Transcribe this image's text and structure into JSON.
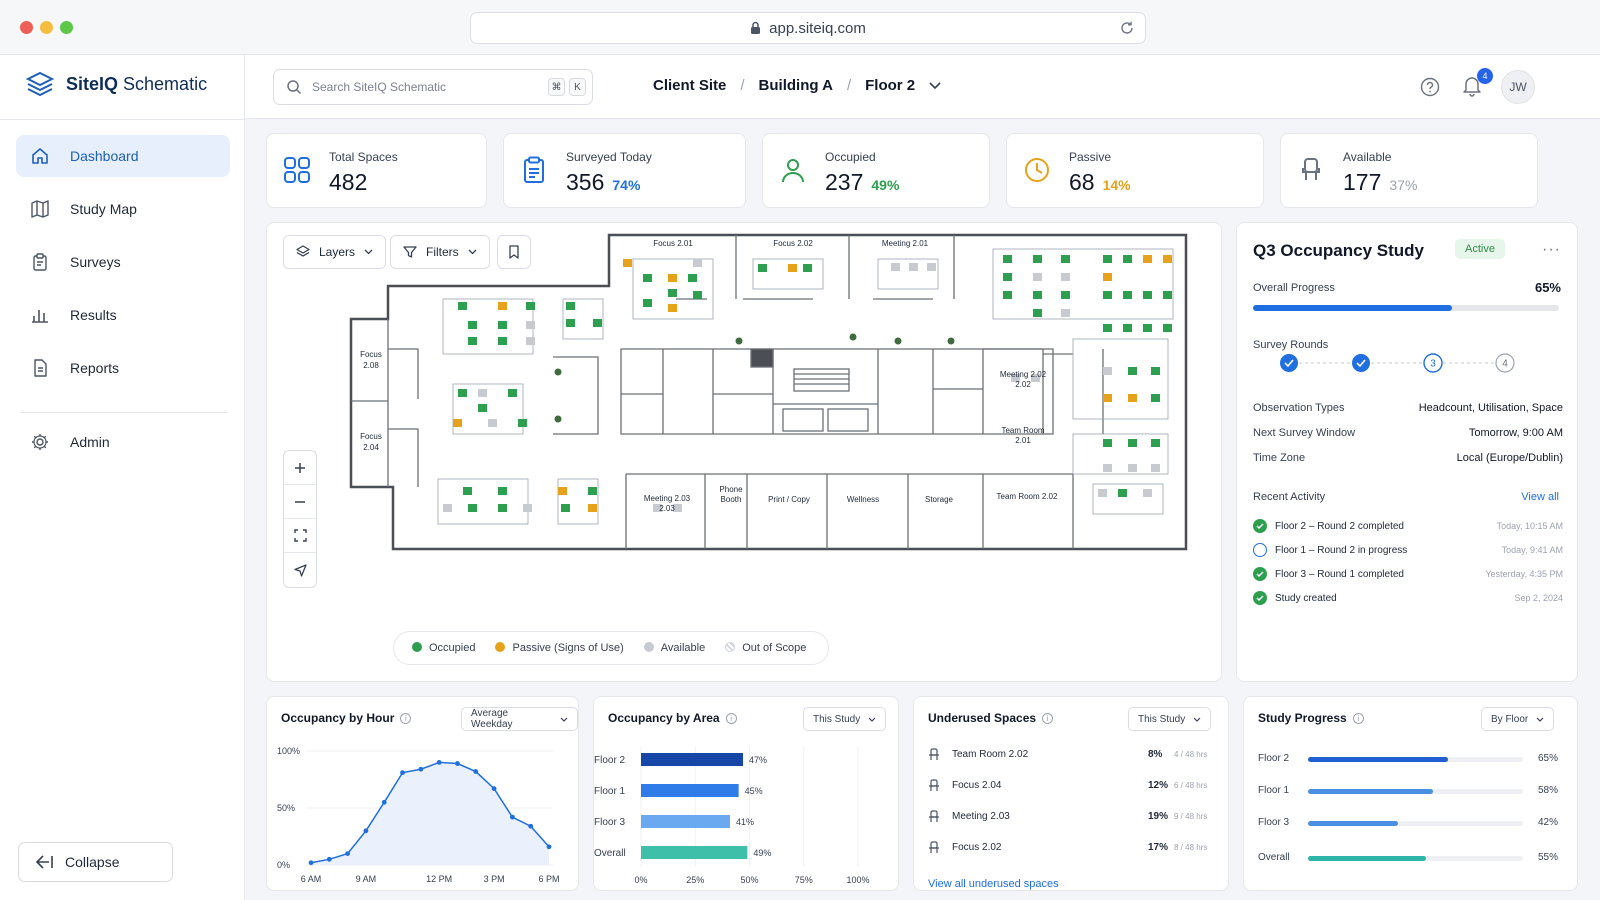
{
  "browser": {
    "url": "app.siteiq.com"
  },
  "app": {
    "name_bold": "SiteIQ",
    "name_light": "Schematic"
  },
  "sidebar": {
    "items": [
      {
        "label": "Dashboard",
        "icon": "home-icon",
        "active": true
      },
      {
        "label": "Study Map",
        "icon": "map-icon"
      },
      {
        "label": "Surveys",
        "icon": "clipboard-icon"
      },
      {
        "label": "Results",
        "icon": "bar-chart-icon"
      },
      {
        "label": "Reports",
        "icon": "document-icon"
      },
      {
        "label": "Admin",
        "icon": "gear-icon"
      }
    ],
    "collapse_label": "Collapse"
  },
  "topbar": {
    "search_placeholder": "Search SiteIQ Schematic",
    "kbd1": "⌘",
    "kbd2": "K",
    "breadcrumb": [
      "Client Site",
      "Building A",
      "Floor 2"
    ],
    "notifications": "4",
    "user_initials": "JW"
  },
  "kpis": [
    {
      "label": "Total Spaces",
      "value": "482",
      "pct": "",
      "icon": "grid-icon"
    },
    {
      "label": "Surveyed Today",
      "value": "356",
      "pct": "74%",
      "icon": "clipboard-icon",
      "color": "#1f6fe0"
    },
    {
      "label": "Occupied",
      "value": "237",
      "pct": "49%",
      "icon": "person-icon",
      "color": "#2e9e4f"
    },
    {
      "label": "Passive",
      "value": "68",
      "pct": "14%",
      "icon": "clock-icon",
      "color": "#e6a21b"
    },
    {
      "label": "Available",
      "value": "177",
      "pct": "37%",
      "icon": "chair-icon",
      "color": "#9ca3af"
    }
  ],
  "map": {
    "layers_label": "Layers",
    "filters_label": "Filters",
    "rooms": {
      "focus_201": "Focus 2.01",
      "focus_202": "Focus 2.02",
      "meeting_201": "Meeting 2.01",
      "focus_208_a": "Focus",
      "focus_208_b": "2.08",
      "focus_204_a": "Focus",
      "focus_204_b": "2.04",
      "meeting_202_a": "Meeting 2.02",
      "meeting_202_b": "2.02",
      "team_201_a": "Team Room",
      "team_201_b": "2.01",
      "meeting_203_a": "Meeting 2.03",
      "meeting_203_b": "2.03",
      "phone_a": "Phone",
      "phone_b": "Booth",
      "print": "Print / Copy",
      "wellness": "Wellness",
      "storage": "Storage",
      "team_202": "Team Room 2.02"
    },
    "legend": [
      {
        "label": "Occupied",
        "color": "#2e9e4f"
      },
      {
        "label": "Passive (Signs of Use)",
        "color": "#e6a21b"
      },
      {
        "label": "Available",
        "color": "#c7cbd1"
      },
      {
        "label": "Out of Scope",
        "color": "hatched"
      }
    ]
  },
  "study": {
    "title": "Q3 Occupancy Study",
    "status": "Active",
    "progress_label": "Overall Progress",
    "progress_value": "65%",
    "progress_fraction": 0.65,
    "rounds_label": "Survey Rounds",
    "rounds": [
      {
        "label": "",
        "state": "done"
      },
      {
        "label": "",
        "state": "done"
      },
      {
        "label": "3",
        "state": "current"
      },
      {
        "label": "4",
        "state": "upcoming"
      }
    ],
    "meta": [
      {
        "k": "Observation Types",
        "v": "Headcount, Utilisation, Space"
      },
      {
        "k": "Next Survey Window",
        "v": "Tomorrow, 9:00 AM"
      },
      {
        "k": "Time Zone",
        "v": "Local (Europe/Dublin)"
      }
    ],
    "activity_title": "Recent Activity",
    "activity_link": "View all",
    "activity": [
      {
        "text": "Floor 2 – Round 2 completed",
        "time": "Today, 10:15 AM",
        "state": "done"
      },
      {
        "text": "Floor 1 – Round 2 in progress",
        "time": "Today, 9:41 AM",
        "state": "progress"
      },
      {
        "text": "Floor 3 – Round 1 completed",
        "time": "Yesterday, 4:35 PM",
        "state": "done"
      },
      {
        "text": "Study created",
        "time": "Sep 2, 2024",
        "state": "done"
      }
    ]
  },
  "cards": {
    "hour": {
      "title": "Occupancy by Hour",
      "select": "Average Weekday"
    },
    "area": {
      "title": "Occupancy by Area",
      "select": "This Study"
    },
    "under": {
      "title": "Underused Spaces",
      "select": "This Study",
      "rows": [
        {
          "name": "Team Room 2.02",
          "pct": "8%",
          "hrs": "4 / 48 hrs"
        },
        {
          "name": "Focus 2.04",
          "pct": "12%",
          "hrs": "6 / 48 hrs"
        },
        {
          "name": "Meeting 2.03",
          "pct": "19%",
          "hrs": "9 / 48 hrs"
        },
        {
          "name": "Focus 2.02",
          "pct": "17%",
          "hrs": "8 / 48 hrs"
        }
      ],
      "link": "View all underused spaces"
    },
    "progress": {
      "title": "Study Progress",
      "select": "By Floor",
      "rows": [
        {
          "name": "Floor 2",
          "pct": "65%",
          "value": 65,
          "color": "#1f5fd1"
        },
        {
          "name": "Floor 1",
          "pct": "58%",
          "value": 58,
          "color": "#4a90e2"
        },
        {
          "name": "Floor 3",
          "pct": "42%",
          "value": 42,
          "color": "#4a90e2"
        },
        {
          "name": "Overall",
          "pct": "55%",
          "value": 55,
          "color": "#2cb5a6"
        }
      ]
    }
  },
  "chart_data": [
    {
      "type": "area",
      "title": "Occupancy by Hour",
      "x": [
        "6 AM",
        "7 AM",
        "8 AM",
        "9 AM",
        "10 AM",
        "11 AM",
        "12 PM",
        "1 PM",
        "2 PM",
        "3 PM",
        "4 PM",
        "5 PM",
        "6 PM",
        "7 PM"
      ],
      "xtick_labels": [
        "6 AM",
        "9 AM",
        "12 PM",
        "3 PM",
        "6 PM"
      ],
      "values": [
        2,
        5,
        10,
        30,
        55,
        81,
        84,
        90,
        89,
        82,
        67,
        42,
        34,
        16
      ],
      "ytick_labels": [
        "100%",
        "50%",
        "0%"
      ],
      "ylim": [
        0,
        100
      ],
      "color": "#1f6fe0"
    },
    {
      "type": "bar",
      "title": "Occupancy by Area",
      "orientation": "horizontal",
      "categories": [
        "Floor 2",
        "Floor 1",
        "Floor 3",
        "Overall"
      ],
      "values": [
        47,
        45,
        41,
        49
      ],
      "value_labels": [
        "47%",
        "45%",
        "41%",
        "49%"
      ],
      "colors": [
        "#1747a6",
        "#2f7ce8",
        "#6aa9ef",
        "#3dbfa9"
      ],
      "xtick_labels": [
        "0%",
        "25%",
        "50%",
        "75%",
        "100%"
      ],
      "xlim": [
        0,
        100
      ]
    }
  ]
}
